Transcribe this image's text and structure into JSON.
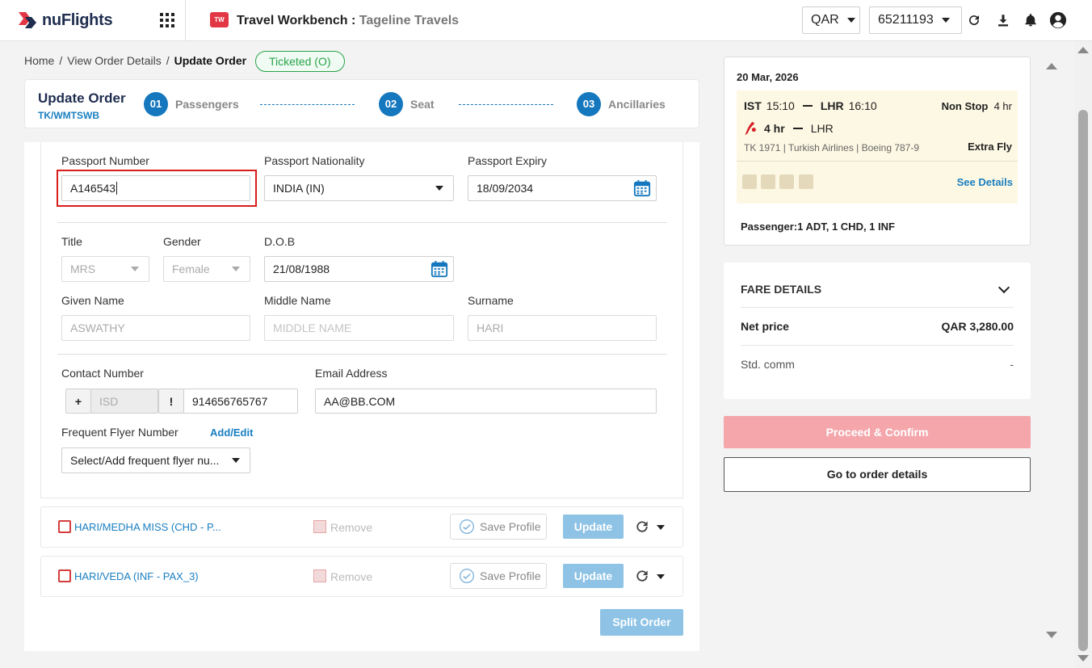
{
  "header": {
    "logo_text": "nuFlights",
    "title": "Travel Workbench",
    "title_separator": " : ",
    "subtitle": "Tageline Travels",
    "currency": "QAR",
    "account": "65211193"
  },
  "breadcrumb": {
    "home": "Home",
    "view_order": "View Order Details",
    "current": "Update Order",
    "sep": "/"
  },
  "status_badge": "Ticketed (O)",
  "order": {
    "title": "Update Order",
    "code": "TK/WMTSWB"
  },
  "steps": [
    {
      "num": "01",
      "label": "Passengers"
    },
    {
      "num": "02",
      "label": "Seat"
    },
    {
      "num": "03",
      "label": "Ancillaries"
    }
  ],
  "form": {
    "passport_number": {
      "label": "Passport Number",
      "value": "A146543"
    },
    "passport_nationality": {
      "label": "Passport Nationality",
      "value": "INDIA (IN)"
    },
    "passport_expiry": {
      "label": "Passport Expiry",
      "value": "18/09/2034"
    },
    "title": {
      "label": "Title",
      "value": "MRS"
    },
    "gender": {
      "label": "Gender",
      "value": "Female"
    },
    "dob": {
      "label": "D.O.B",
      "value": "21/08/1988"
    },
    "given_name": {
      "label": "Given Name",
      "value": "ASWATHY"
    },
    "middle_name": {
      "label": "Middle Name",
      "placeholder": "MIDDLE NAME"
    },
    "surname": {
      "label": "Surname",
      "value": "HARI"
    },
    "contact": {
      "label": "Contact Number",
      "plus": "+",
      "isd_placeholder": "ISD",
      "bang": "!",
      "value": "914656765767"
    },
    "email": {
      "label": "Email Address",
      "value": "AA@BB.COM"
    },
    "ffn": {
      "label": "Frequent Flyer Number",
      "link": "Add/Edit",
      "value": "Select/Add frequent flyer nu..."
    }
  },
  "passengers": [
    {
      "name": "HARI/MEDHA MISS (CHD - P...",
      "remove": "Remove",
      "save_profile": "Save Profile",
      "update": "Update"
    },
    {
      "name": "HARI/VEDA (INF - PAX_3)",
      "remove": "Remove",
      "save_profile": "Save Profile",
      "update": "Update"
    }
  ],
  "split_order": "Split Order",
  "flight": {
    "date": "20 Mar, 2026",
    "origin": "IST",
    "dep_time": "15:10",
    "destination": "LHR",
    "arr_time": "16:10",
    "stops": "Non Stop",
    "duration": "4 hr",
    "leg_duration": "4 hr",
    "leg_dest": "LHR",
    "details": "TK 1971 | Turkish Airlines | Boeing 787-9",
    "fare_brand": "Extra Fly",
    "see_details": "See Details",
    "passengers": "Passenger:1 ADT, 1 CHD, 1 INF",
    "amenity_icons": [
      "wifi-icon",
      "seat-icon",
      "meal-icon",
      "baggage-icon"
    ]
  },
  "fare": {
    "title": "FARE DETAILS",
    "net_label": "Net price",
    "net_value": "QAR 3,280.00",
    "comm_label": "Std. comm",
    "comm_value": "-"
  },
  "buttons": {
    "proceed": "Proceed & Confirm",
    "goto": "Go to order details"
  },
  "colors": {
    "brand_blue": "#1577bd",
    "highlight_red": "#d91c1c",
    "ticketed_green": "#2aa34a",
    "proceed_disabled": "#f4a6ab"
  }
}
